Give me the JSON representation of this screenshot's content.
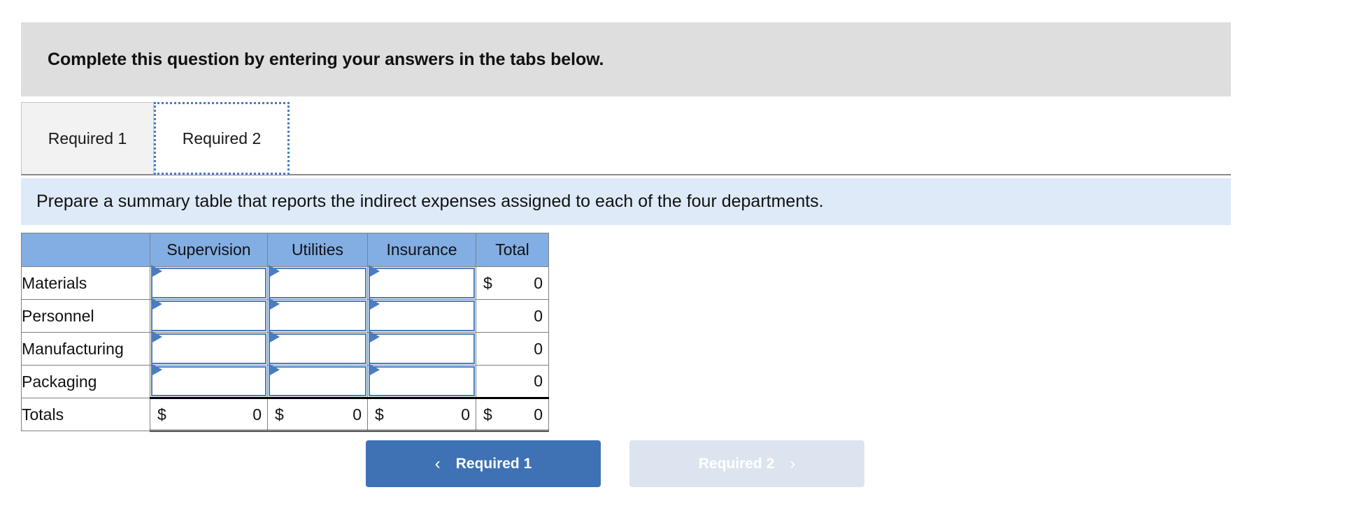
{
  "banner": {
    "text": "Complete this question by entering your answers in the tabs below."
  },
  "tabs": [
    {
      "label": "Required 1",
      "state": "inactive"
    },
    {
      "label": "Required 2",
      "state": "active"
    }
  ],
  "instruction": {
    "text": "Prepare a summary table that reports the indirect expenses assigned to each of the four departments."
  },
  "table": {
    "corner_header": "",
    "columns": [
      "Supervision",
      "Utilities",
      "Insurance",
      "Total"
    ],
    "rows": [
      {
        "label": "Materials",
        "inputs": [
          "",
          "",
          ""
        ],
        "total_symbol": "$",
        "total_value": "0"
      },
      {
        "label": "Personnel",
        "inputs": [
          "",
          "",
          ""
        ],
        "total_symbol": "",
        "total_value": "0"
      },
      {
        "label": "Manufacturing",
        "inputs": [
          "",
          "",
          ""
        ],
        "total_symbol": "",
        "total_value": "0"
      },
      {
        "label": "Packaging",
        "inputs": [
          "",
          "",
          ""
        ],
        "total_symbol": "",
        "total_value": "0"
      }
    ],
    "totals_row": {
      "label": "Totals",
      "cells": [
        {
          "symbol": "$",
          "value": "0"
        },
        {
          "symbol": "$",
          "value": "0"
        },
        {
          "symbol": "$",
          "value": "0"
        },
        {
          "symbol": "$",
          "value": "0"
        }
      ]
    }
  },
  "nav": {
    "prev_label": "Required 1",
    "prev_icon": "chevron-left-icon",
    "next_label": "Required 2",
    "next_icon": "chevron-right-icon",
    "prev_chevron": "‹",
    "next_chevron": "›"
  },
  "colors": {
    "banner_bg": "#dedede",
    "instruction_bg": "#deeaf7",
    "header_blue": "#83aee3",
    "accent_blue": "#3f72b4",
    "disabled_btn": "#dce4ef",
    "focus_outline": "#4a7cc0"
  }
}
